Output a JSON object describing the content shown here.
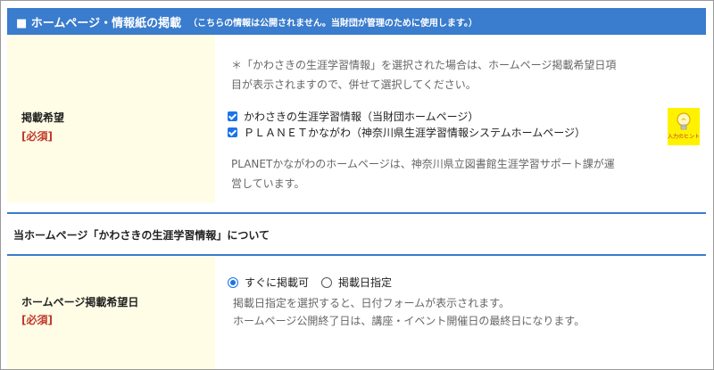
{
  "header": {
    "title": "■ ホームページ・情報紙の掲載",
    "subtitle": "（こちらの情報は公開されません。当財団が管理のために使用します。）"
  },
  "publish_section": {
    "label": "掲載希望",
    "required": "[必須]",
    "note_line1": "＊「かわさきの生涯学習情報」を選択された場合は、ホームページ掲載希望日項",
    "note_line2": "目が表示されますので、併せて選択してください。",
    "options": [
      {
        "label": "かわさきの生涯学習情報（当財団ホームページ）",
        "checked": true
      },
      {
        "label": "ＰＬＡＮＥＴかながわ（神奈川県生涯学習情報システムホームページ）",
        "checked": true
      }
    ],
    "planet_note_line1": "PLANETかながわのホームページは、神奈川県立図書館生涯学習サポート課が運",
    "planet_note_line2": "営しています。",
    "hint_label": "入力のヒント"
  },
  "about_section": {
    "title": "当ホームページ「かわさきの生涯学習情報」について"
  },
  "date_section": {
    "label": "ホームページ掲載希望日",
    "required": "[必須]",
    "radio_options": [
      {
        "label": "すぐに掲載可",
        "selected": true
      },
      {
        "label": "掲載日指定",
        "selected": false
      }
    ],
    "note_line1": "掲載日指定を選択すると、日付フォームが表示されます。",
    "note_line2": "ホームページ公開終了日は、講座・イベント開催日の最終日になります。"
  },
  "colors": {
    "header_bg": "#3a7ccd",
    "label_bg": "#fffde6",
    "required_text": "#c0392b",
    "checkbox_accent": "#1a73e8",
    "hint_bg": "#fff200"
  }
}
